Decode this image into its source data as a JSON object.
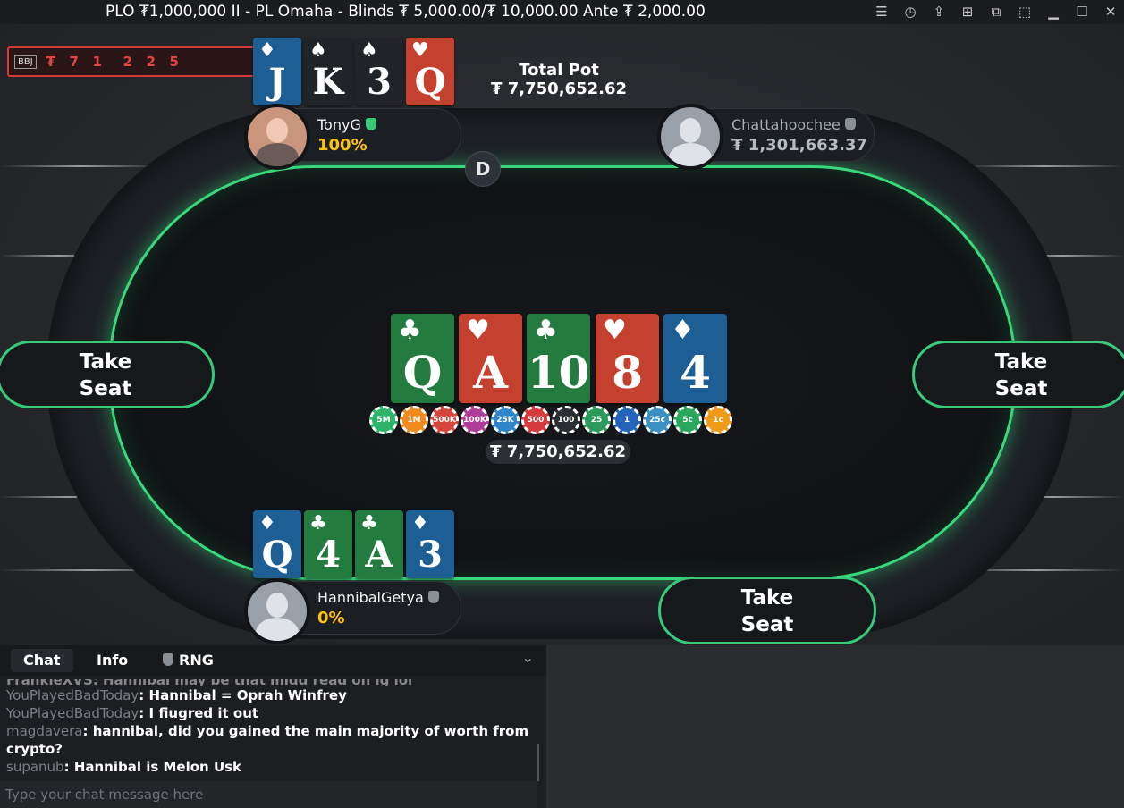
{
  "window": {
    "title": "PLO ₮1,000,000 II - PL Omaha - Blinds ₮ 5,000.00/₮ 10,000.00 Ante ₮ 2,000.00",
    "controls": [
      "menu-icon",
      "history-icon",
      "share-icon",
      "grid-icon",
      "tables-icon",
      "minimize-to-tray-icon",
      "minimize-icon",
      "maximize-icon",
      "close-icon"
    ]
  },
  "bad_beat": {
    "logo": "BBJ",
    "digits": [
      "₮",
      "7",
      "1",
      "2",
      "2",
      "5"
    ]
  },
  "total_pot": {
    "label": "Total Pot",
    "value": "₮ 7,750,652.62"
  },
  "players": {
    "top_left": {
      "name": "TonyG",
      "stack": "100%",
      "verified": true,
      "cards": [
        {
          "rank": "J",
          "suit": "♦"
        },
        {
          "rank": "K",
          "suit": "♠"
        },
        {
          "rank": "3",
          "suit": "♠"
        },
        {
          "rank": "Q",
          "suit": "♥"
        }
      ]
    },
    "top_right": {
      "name": "Chattahoochee",
      "stack": "₮ 1,301,663.37",
      "verified": false
    },
    "bottom": {
      "name": "HannibalGetya",
      "stack": "0%",
      "verified": false,
      "cards": [
        {
          "rank": "Q",
          "suit": "♦"
        },
        {
          "rank": "4",
          "suit": "♣"
        },
        {
          "rank": "A",
          "suit": "♣"
        },
        {
          "rank": "3",
          "suit": "♦"
        }
      ]
    }
  },
  "dealer_button": "D",
  "board": [
    {
      "rank": "Q",
      "suit": "♣"
    },
    {
      "rank": "A",
      "suit": "♥"
    },
    {
      "rank": "10",
      "suit": "♣"
    },
    {
      "rank": "8",
      "suit": "♥"
    },
    {
      "rank": "4",
      "suit": "♦"
    }
  ],
  "chips": [
    {
      "label": "5M",
      "color": "#2db36a"
    },
    {
      "label": "1M",
      "color": "#f08a1c"
    },
    {
      "label": "500K",
      "color": "#d4453a"
    },
    {
      "label": "100K",
      "color": "#b03c9a"
    },
    {
      "label": "25K",
      "color": "#2e86c8"
    },
    {
      "label": "500",
      "color": "#d63a3a"
    },
    {
      "label": "100",
      "color": "#2a2d31"
    },
    {
      "label": "25",
      "color": "#2b9a5a"
    },
    {
      "label": "1",
      "color": "#2364b8"
    },
    {
      "label": "25c",
      "color": "#3a8fc0"
    },
    {
      "label": "5c",
      "color": "#2aa65d"
    },
    {
      "label": "1c",
      "color": "#f09a1a"
    }
  ],
  "pot": "₮ 7,750,652.62",
  "seats": {
    "left": "Take\nSeat",
    "right": "Take\nSeat",
    "bottom_right": "Take\nSeat"
  },
  "seat_line1": "Take",
  "seat_line2": "Seat",
  "chat": {
    "tabs": [
      "Chat",
      "Info",
      "RNG"
    ],
    "partial_line": "FrankieXVS: Hannibal may be that midd read on ig lol",
    "messages": [
      {
        "user": "YouPlayedBadToday",
        "text": "Hannibal = Oprah Winfrey"
      },
      {
        "user": "YouPlayedBadToday",
        "text": "I fiugred it out"
      },
      {
        "user": "magdavera",
        "text": "hannibal, did you gained the main majority of worth from crypto?"
      },
      {
        "user": "supanub",
        "text": "Hannibal is Melon Usk"
      }
    ],
    "input_placeholder": "Type your chat message here"
  },
  "colors": {
    "felt_glow": "#38d97a",
    "stack_highlight": "#ffc30d",
    "diamonds": "#1d5f95",
    "hearts": "#c5412f",
    "clubs": "#237b3f",
    "spades": "#202327"
  }
}
